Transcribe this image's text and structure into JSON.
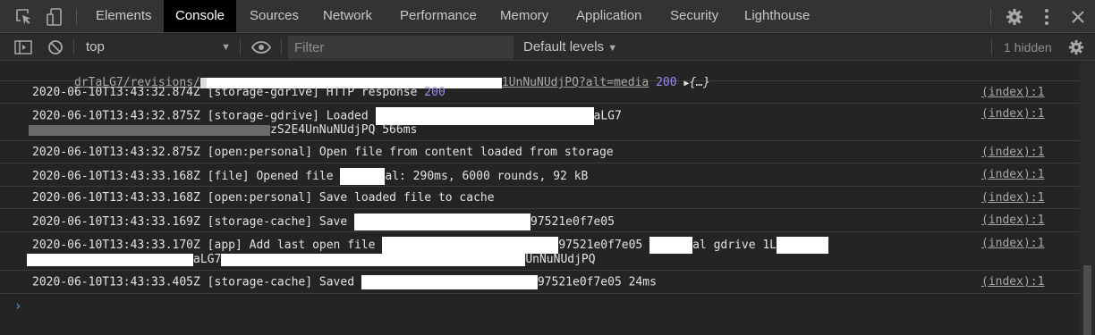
{
  "tabs": [
    {
      "label": "Elements"
    },
    {
      "label": "Console"
    },
    {
      "label": "Sources"
    },
    {
      "label": "Network"
    },
    {
      "label": "Performance"
    },
    {
      "label": "Memory"
    },
    {
      "label": "Application"
    },
    {
      "label": "Security"
    },
    {
      "label": "Lighthouse"
    }
  ],
  "toolbar": {
    "context": "top",
    "filter_placeholder": "Filter",
    "levels": "Default levels",
    "hidden": "1 hidden"
  },
  "messages": [
    {
      "line1": "drTaLG7/revisions/",
      "line1_tail": "1UnNuNUdjPQ?alt=media",
      "status": "200",
      "obj": "{…}"
    },
    {
      "text": "2020-06-10T13:43:32.874Z [storage-gdrive] HTTP response ",
      "status": "200",
      "source": "(index):1"
    },
    {
      "text_a": "2020-06-10T13:43:32.875Z [storage-gdrive] Loaded ",
      "text_b": "aLG7",
      "text_c": "zS2E4UnNuNUdjPQ 566ms",
      "source": "(index):1"
    },
    {
      "text": "2020-06-10T13:43:32.875Z [open:personal] Open file from content loaded from storage",
      "source": "(index):1"
    },
    {
      "text_a": "2020-06-10T13:43:33.168Z [file] Opened file ",
      "text_b": "al: 290ms, 6000 rounds, 92 kB",
      "source": "(index):1"
    },
    {
      "text": "2020-06-10T13:43:33.168Z [open:personal] Save loaded file to cache",
      "source": "(index):1"
    },
    {
      "text_a": "2020-06-10T13:43:33.169Z [storage-cache] Save ",
      "text_b": "97521e0f7e05",
      "source": "(index):1"
    },
    {
      "text_a": "2020-06-10T13:43:33.170Z [app] Add last open file ",
      "text_b": "97521e0f7e05 ",
      "text_c": "al gdrive 1L",
      "text_d": "aLG7",
      "text_e": "UnNuNUdjPQ",
      "source": "(index):1"
    },
    {
      "text_a": "2020-06-10T13:43:33.405Z [storage-cache] Saved ",
      "text_b": "97521e0f7e05 24ms",
      "source": "(index):1"
    }
  ],
  "prompt": "›",
  "colors": {
    "accent_number": "#9b8cf0",
    "prompt": "#4fa3f7"
  },
  "icons": [
    "inspect-element-icon",
    "device-toolbar-icon",
    "sidebar-toggle-icon",
    "clear-console-icon",
    "eye-icon",
    "gear-icon",
    "more-vertical-icon",
    "close-icon",
    "settings-gear-icon"
  ]
}
